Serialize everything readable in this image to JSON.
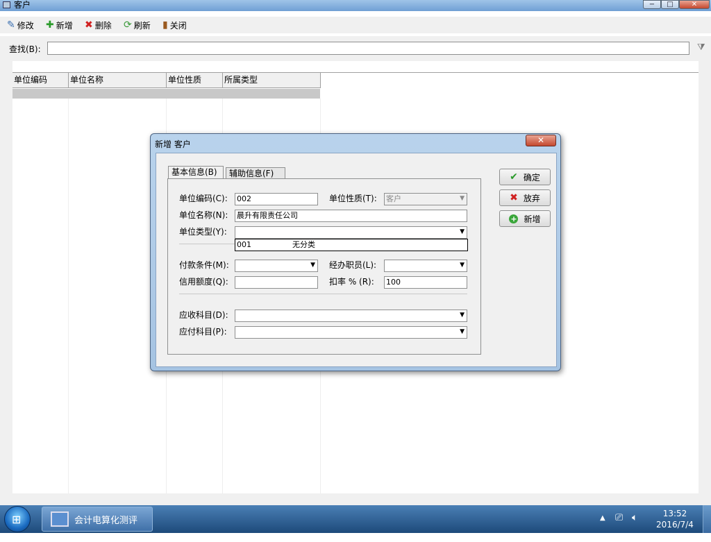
{
  "window": {
    "title": "客户",
    "minimize": "−",
    "maximize": "□",
    "close": "✕"
  },
  "toolbar": {
    "edit": "修改",
    "add": "新增",
    "delete": "删除",
    "refresh": "刷新",
    "close": "关闭"
  },
  "search": {
    "label": "查找(B):",
    "value": ""
  },
  "grid": {
    "columns": [
      "单位编码",
      "单位名称",
      "单位性质",
      "所属类型"
    ]
  },
  "dialog": {
    "title": "新增 客户",
    "close": "✕",
    "tabs": [
      "基本信息(B)",
      "辅助信息(F)"
    ],
    "fields": {
      "code_label": "单位编码(C):",
      "code_value": "002",
      "nature_label": "单位性质(T):",
      "nature_value": "客户",
      "name_label": "单位名称(N):",
      "name_value": "晨升有限责任公司",
      "type_label": "单位类型(Y):",
      "type_value": "",
      "type_option_code": "001",
      "type_option_name": "无分类",
      "payment_label": "付款条件(M):",
      "payment_value": "",
      "handler_label": "经办职员(L):",
      "handler_value": "",
      "credit_label": "信用额度(Q):",
      "credit_value": "",
      "discount_label": "扣率 % (R):",
      "discount_value": "100",
      "receivable_label": "应收科目(D):",
      "receivable_value": "",
      "payable_label": "应付科目(P):",
      "payable_value": ""
    },
    "buttons": {
      "ok": "确定",
      "cancel": "放弃",
      "add": "新增"
    }
  },
  "taskbar": {
    "app": "会计电算化测评",
    "time": "13:52",
    "date": "2016/7/4"
  }
}
